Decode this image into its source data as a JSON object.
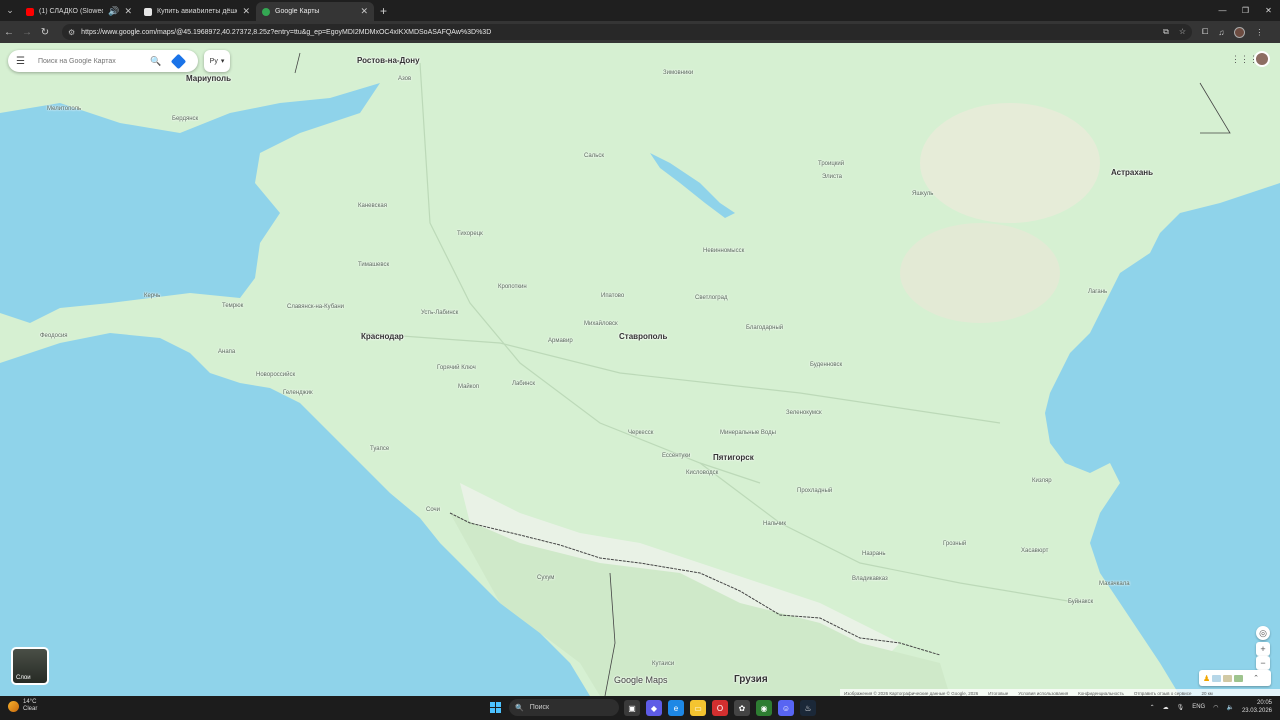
{
  "browser": {
    "tabs": [
      {
        "title": "(1) СЛАДКО (Slowed + Re...",
        "favicon_color": "#ff0000"
      },
      {
        "title": "Купить авиабилеты дёшево о...",
        "favicon_color": "#e6e6e6"
      },
      {
        "title": "Google Карты",
        "favicon_color": "#34a853"
      }
    ],
    "url": "https://www.google.com/maps/@45.1968972,40.27372,8.25z?entry=ttu&g_ep=EgoyMDI2MDMxOC4xIKXMDSoASAFQAw%3D%3D"
  },
  "maps": {
    "search_placeholder": "Поиск на Google Картах",
    "language_label": "Ру",
    "layers_label": "Слои",
    "logo": "Google Maps",
    "footer": [
      "Изображения © 2026 Картографические данные © Google, 2026",
      "Итоговые",
      "Условия использования",
      "Конфиденциальность",
      "Отправить отзыв о сервисе",
      "20 км"
    ],
    "places": [
      {
        "name": "Ростов-на-Дону",
        "type": "big"
      },
      {
        "name": "Мариуполь",
        "type": "big"
      },
      {
        "name": "Краснодар",
        "type": "big"
      },
      {
        "name": "Ставрополь",
        "type": "big"
      },
      {
        "name": "Пятигорск",
        "type": "big"
      },
      {
        "name": "Астрахань",
        "type": "big"
      },
      {
        "name": "Грузия",
        "type": "country"
      },
      {
        "name": "Мелитополь",
        "type": "small"
      },
      {
        "name": "Бердянск",
        "type": "small"
      },
      {
        "name": "Азов",
        "type": "small"
      },
      {
        "name": "Зимовники",
        "type": "small"
      },
      {
        "name": "Элиста",
        "type": "small"
      },
      {
        "name": "Троицкий",
        "type": "small"
      },
      {
        "name": "Сальск",
        "type": "small"
      },
      {
        "name": "Тимашевск",
        "type": "small"
      },
      {
        "name": "Кропоткин",
        "type": "small"
      },
      {
        "name": "Керчь",
        "type": "small"
      },
      {
        "name": "Феодосия",
        "type": "small"
      },
      {
        "name": "Темрюк",
        "type": "small"
      },
      {
        "name": "Анапа",
        "type": "small"
      },
      {
        "name": "Новороссийск",
        "type": "small"
      },
      {
        "name": "Геленджик",
        "type": "small"
      },
      {
        "name": "Туапсе",
        "type": "small"
      },
      {
        "name": "Сочи",
        "type": "small"
      },
      {
        "name": "Армавир",
        "type": "small"
      },
      {
        "name": "Михайловск",
        "type": "small"
      },
      {
        "name": "Невинномысск",
        "type": "small"
      },
      {
        "name": "Черкесск",
        "type": "small"
      },
      {
        "name": "Ессентуки",
        "type": "small"
      },
      {
        "name": "Кисловодск",
        "type": "small"
      },
      {
        "name": "Минеральные Воды",
        "type": "small"
      },
      {
        "name": "Нальчик",
        "type": "small"
      },
      {
        "name": "Владикавказ",
        "type": "small"
      },
      {
        "name": "Грозный",
        "type": "small"
      },
      {
        "name": "Хасавюрт",
        "type": "small"
      },
      {
        "name": "Махачкала",
        "type": "small"
      },
      {
        "name": "Буйнакск",
        "type": "small"
      },
      {
        "name": "Кизляр",
        "type": "small"
      },
      {
        "name": "Буденновск",
        "type": "small"
      },
      {
        "name": "Благодарный",
        "type": "small"
      },
      {
        "name": "Светлоград",
        "type": "small"
      },
      {
        "name": "Ипатово",
        "type": "small"
      },
      {
        "name": "Зеленокумск",
        "type": "small"
      },
      {
        "name": "Прохладный",
        "type": "small"
      },
      {
        "name": "Яшкуль",
        "type": "small"
      },
      {
        "name": "Лагань",
        "type": "small"
      },
      {
        "name": "Сухум",
        "type": "small"
      },
      {
        "name": "Кутаиси",
        "type": "small"
      },
      {
        "name": "Майкоп",
        "type": "small"
      },
      {
        "name": "Лабинск",
        "type": "small"
      },
      {
        "name": "Горячий Ключ",
        "type": "small"
      },
      {
        "name": "Усть-Лабинск",
        "type": "small"
      },
      {
        "name": "Славянск-на-Кубани",
        "type": "small"
      },
      {
        "name": "Каневская",
        "type": "small"
      },
      {
        "name": "Тихорецк",
        "type": "small"
      },
      {
        "name": "Назрань",
        "type": "small"
      }
    ]
  },
  "taskbar": {
    "weather_temp": "14°C",
    "weather_desc": "Clear",
    "search_label": "Поиск",
    "lang": "ENG",
    "time": "20:05",
    "date": "23.03.2026"
  },
  "colors": {
    "land": "#d6f0d2",
    "water": "#8fd3ea",
    "accent": "#1a73e8"
  }
}
